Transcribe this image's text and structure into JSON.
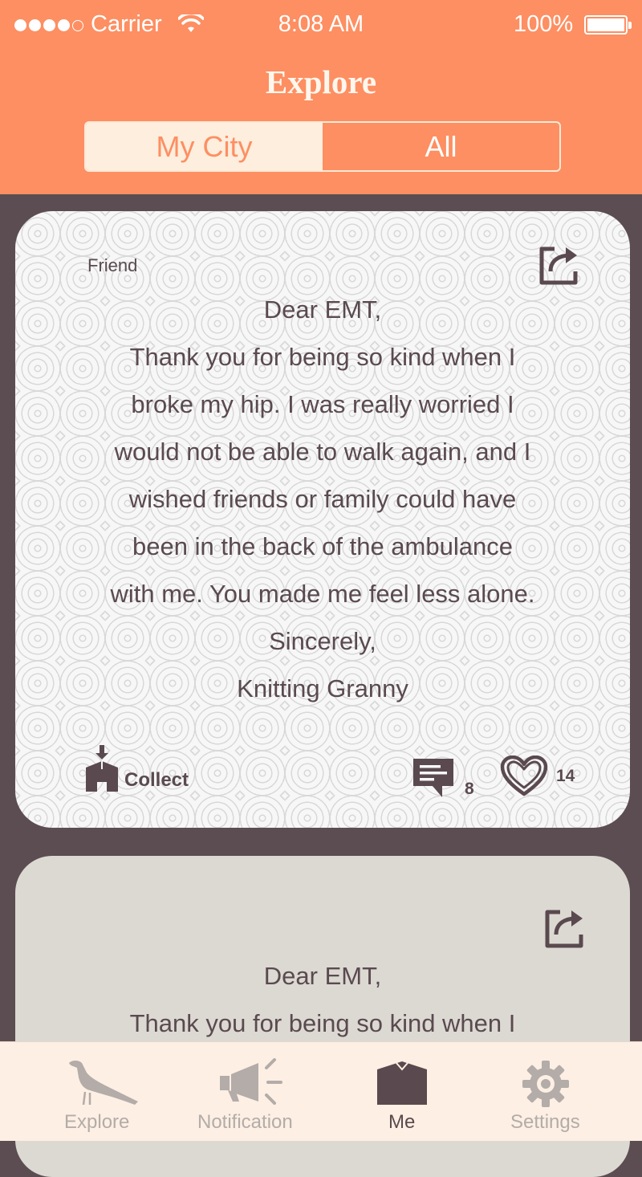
{
  "status_bar": {
    "carrier": "Carrier",
    "time": "8:08 AM",
    "battery": "100%"
  },
  "header": {
    "title": "Explore",
    "segments": [
      "My City",
      "All"
    ],
    "selected_segment": "My City"
  },
  "cards": [
    {
      "tag": "Friend",
      "letter_lines": [
        "Dear EMT,",
        "Thank you for being so kind when I",
        "broke my hip. I was really worried I",
        "would not be able to walk again, and I",
        "wished friends or family could have",
        "been in the back of the ambulance",
        "with me. You made me feel less alone.",
        "Sincerely,",
        "Knitting Granny"
      ],
      "collect_label": "Collect",
      "comment_count": "8",
      "like_count": "14"
    },
    {
      "letter_lines": [
        "Dear EMT,",
        "Thank you for being so kind when I"
      ]
    }
  ],
  "tabbar": {
    "tabs": [
      {
        "label": "Explore",
        "icon": "magpie-bird-icon",
        "active": false
      },
      {
        "label": "Notification",
        "icon": "megaphone-icon",
        "active": false
      },
      {
        "label": "Me",
        "icon": "house-icon",
        "active": true
      },
      {
        "label": "Settings",
        "icon": "gear-icon",
        "active": false
      }
    ]
  },
  "colors": {
    "header_orange": "#fd8f62",
    "background_plum": "#5c4d52",
    "text_dark": "#5a4a4f",
    "tab_inactive": "#b3aca9",
    "tabbar_bg": "#fdefe3"
  }
}
